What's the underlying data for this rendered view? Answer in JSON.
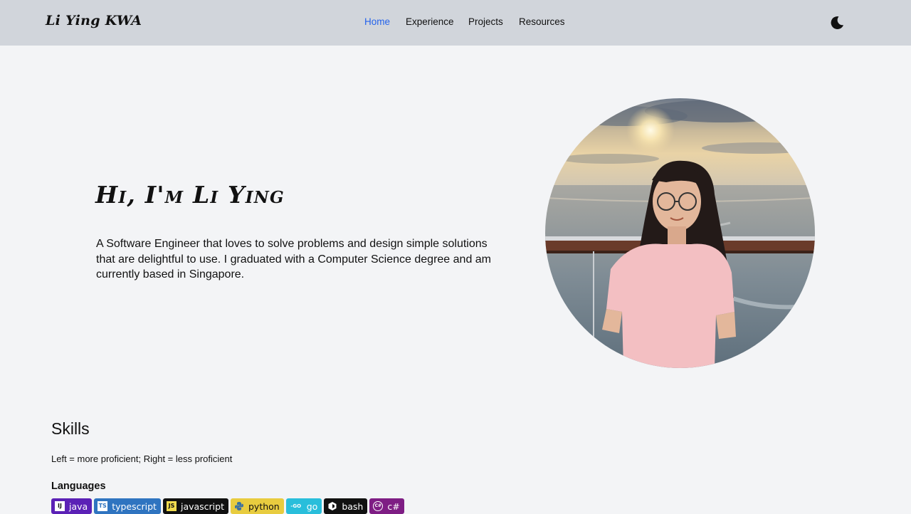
{
  "header": {
    "brand": "Li Ying KWA",
    "nav": [
      {
        "label": "Home",
        "active": true
      },
      {
        "label": "Experience",
        "active": false
      },
      {
        "label": "Projects",
        "active": false
      },
      {
        "label": "Resources",
        "active": false
      }
    ],
    "theme_toggle_icon": "moon-icon"
  },
  "hero": {
    "title": "Hi, I'm Li Ying",
    "description": "A Software Engineer that loves to solve problems and design simple solutions that are delightful to use. I graduated with a Computer Science degree and am currently based in Singapore.",
    "photo_icon": "portrait-photo"
  },
  "skills": {
    "title": "Skills",
    "note": "Left = more proficient; Right = less proficient",
    "languages_title": "Languages",
    "languages": [
      {
        "label": "java",
        "icon": "intellij-icon",
        "color": "#5b21b6",
        "logo_text": "IJ"
      },
      {
        "label": "typescript",
        "icon": "typescript-icon",
        "color": "#2f74c0",
        "logo_text": "TS"
      },
      {
        "label": "javascript",
        "icon": "javascript-icon",
        "color": "#111111",
        "logo_text": "JS"
      },
      {
        "label": "python",
        "icon": "python-icon",
        "color": "#e8cc3f",
        "logo_text": "",
        "text_color": "#111111"
      },
      {
        "label": "go",
        "icon": "go-icon",
        "color": "#29bedb",
        "logo_text": "-GO"
      },
      {
        "label": "bash",
        "icon": "bash-icon",
        "color": "#111111",
        "logo_text": ""
      },
      {
        "label": "c#",
        "icon": "csharp-icon",
        "color": "#7e1d84",
        "logo_text": "C#"
      }
    ]
  },
  "colors": {
    "header_bg": "#d1d5db",
    "page_bg": "#f3f4f6",
    "nav_active": "#2563eb",
    "text": "#111111"
  }
}
